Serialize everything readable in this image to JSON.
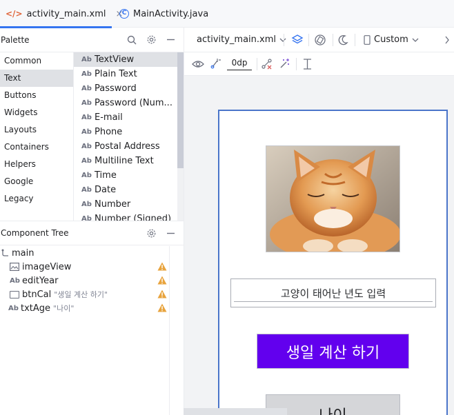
{
  "tabs": [
    {
      "label": "activity_main.xml",
      "icon": "xml-file-icon",
      "close": "×"
    },
    {
      "label": "MainActivity.java",
      "icon": "java-class-icon"
    }
  ],
  "palette": {
    "title": "Palette",
    "categories": [
      "Common",
      "Text",
      "Buttons",
      "Widgets",
      "Layouts",
      "Containers",
      "Helpers",
      "Google",
      "Legacy"
    ],
    "selected_category": "Text",
    "widgets": [
      {
        "icon": "Ab",
        "label": "TextView"
      },
      {
        "icon": "Ab",
        "label": "Plain Text"
      },
      {
        "icon": "Ab",
        "label": "Password"
      },
      {
        "icon": "Ab",
        "label": "Password (Num..."
      },
      {
        "icon": "Ab",
        "label": "E-mail"
      },
      {
        "icon": "Ab",
        "label": "Phone"
      },
      {
        "icon": "Ab",
        "label": "Postal Address"
      },
      {
        "icon": "Ab",
        "label": "Multiline Text"
      },
      {
        "icon": "Ab",
        "label": "Time"
      },
      {
        "icon": "Ab",
        "label": "Date"
      },
      {
        "icon": "Ab",
        "label": "Number"
      },
      {
        "icon": "Ab",
        "label": "Number (Signed)"
      }
    ]
  },
  "component_tree": {
    "title": "Component Tree",
    "root": "main",
    "items": [
      {
        "id": "imageView",
        "hint": ""
      },
      {
        "id": "editYear",
        "hint": ""
      },
      {
        "id": "btnCal",
        "hint": "\"생일 계산 하기\""
      },
      {
        "id": "txtAge",
        "hint": "\"나이\""
      }
    ],
    "ab_label": "Ab"
  },
  "design_toolbar": {
    "file": "activity_main.xml",
    "device": "Custom",
    "margin": "0dp"
  },
  "phone": {
    "edit_hint": "고양이 태어난 년도 입력",
    "button_label": "생일 계산 하기",
    "age_label": "나이"
  },
  "colors": {
    "accent": "#3574f0",
    "button_bg": "#6200ee",
    "warning": "#e8a33d"
  }
}
